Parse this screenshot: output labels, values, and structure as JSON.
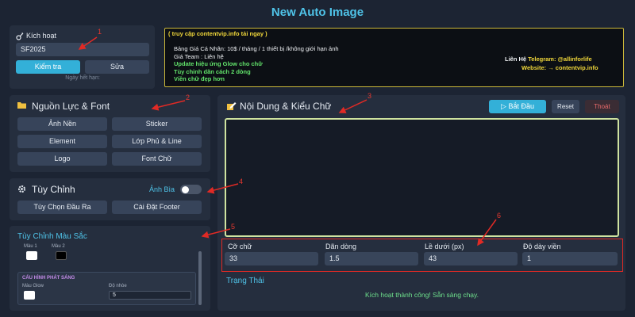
{
  "app": {
    "title": "New Auto Image"
  },
  "activation": {
    "label": "Kích hoạt",
    "key_value": "SF2025",
    "check_label": "Kiểm tra",
    "edit_label": "Sửa",
    "expiry_text": "Ngày hết hạn:"
  },
  "ad": {
    "header": "( truy cập contentvip.info tải ngay )",
    "lines": [
      "Bảng Giá Cá Nhân: 10$ / tháng / 1 thiết bị /không giới hạn ảnh",
      "Giá Team : Liên hệ",
      "Update hiệu ứng Glow cho chữ",
      "Tùy chỉnh dãn cách 2 dòng",
      "Viền chữ đẹp hơn"
    ],
    "contact_label": "Liên Hệ",
    "contact_telegram": "Telegram: @allinforlife",
    "website": "Website: → contentvip.info"
  },
  "resources": {
    "title": "Nguồn Lực & Font",
    "buttons": [
      "Ảnh Nền",
      "Sticker",
      "Element",
      "Lớp Phủ & Line",
      "Logo",
      "Font Chữ"
    ]
  },
  "customize": {
    "title": "Tùy Chỉnh",
    "cover_label": "Ảnh Bìa",
    "output_label": "Tùy Chọn Đầu Ra",
    "footer_label": "Cài Đặt Footer"
  },
  "colors": {
    "title": "Tùy Chỉnh Màu Sắc",
    "color1_label": "Màu 1",
    "color2_label": "Màu 2",
    "glow_header": "CẤU HÌNH PHÁT SÁNG",
    "glow_color_label": "Màu Glow",
    "blur_label": "Độ nhòe",
    "blur_value": "5",
    "color1": "#ffffff",
    "color2": "#000000",
    "glow_color": "#ffffff"
  },
  "content": {
    "title": "Nội Dung & Kiểu Chữ",
    "start_label": "Bắt Đầu",
    "reset_label": "Reset",
    "exit_label": "Thoát",
    "fields": [
      {
        "label": "Cỡ chữ",
        "value": "33"
      },
      {
        "label": "Dãn dòng",
        "value": "1.5"
      },
      {
        "label": "Lề dưới (px)",
        "value": "43"
      },
      {
        "label": "Độ dày viền",
        "value": "1"
      }
    ],
    "status_label": "Trạng Thái",
    "status_message": "Kích hoạt thành công! Sẵn sàng chạy."
  },
  "annotations": [
    "1",
    "2",
    "3",
    "4",
    "5",
    "6"
  ],
  "theme": {
    "background": "#1c2433",
    "panel": "#252e3e",
    "accent": "#4fc3e8",
    "annotation_red": "#e02a25"
  }
}
